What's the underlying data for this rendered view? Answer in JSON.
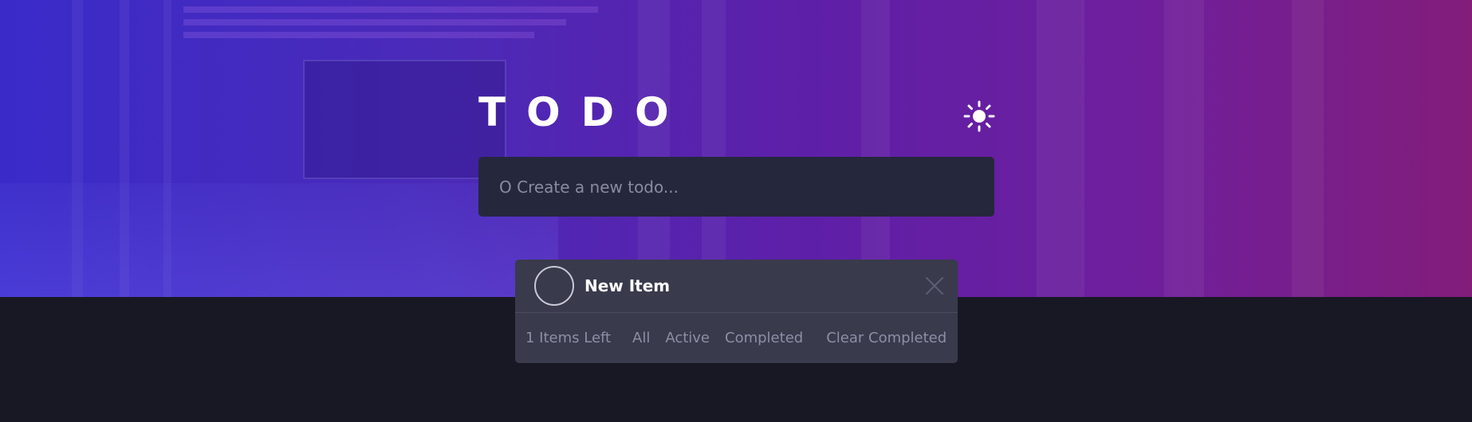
{
  "app": {
    "title": "TODO",
    "theme_icon": "sun-icon"
  },
  "new_todo": {
    "placeholder": "O Create a new todo...",
    "value": ""
  },
  "todos": [
    {
      "label": "New Item",
      "completed": false,
      "check_icon": "circle-check-icon",
      "delete_icon": "close-icon"
    }
  ],
  "footer": {
    "items_left": "1 Items Left",
    "filters": [
      "All",
      "Active",
      "Completed"
    ],
    "clear_label": "Clear Completed"
  },
  "colors": {
    "background": "#181824",
    "panel": "#393a4c",
    "input": "#25273d",
    "gradient_start": "#3a2bc9",
    "gradient_end": "#821d7a"
  }
}
